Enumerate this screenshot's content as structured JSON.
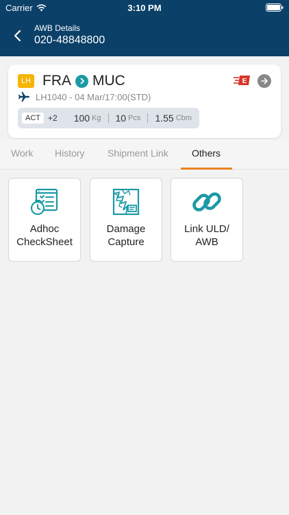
{
  "status_bar": {
    "carrier": "Carrier",
    "time": "3:10 PM"
  },
  "header": {
    "subtitle": "AWB Details",
    "title": "020-48848800"
  },
  "card": {
    "airline_badge": "LH",
    "origin": "FRA",
    "destination": "MUC",
    "flight": "LH1040 - 04 Mar/17:00(STD)",
    "act_label": "ACT",
    "act_extra": "+2",
    "weight": "100",
    "weight_unit": "Kg",
    "pieces": "10",
    "pieces_unit": "Pcs",
    "volume": "1.55",
    "volume_unit": "Cbm",
    "e_badge": "E"
  },
  "tabs": [
    {
      "label": "Work"
    },
    {
      "label": "History"
    },
    {
      "label": "Shipment Link"
    },
    {
      "label": "Others"
    }
  ],
  "active_tab": "Others",
  "tiles": [
    {
      "label": "Adhoc\nCheckSheet",
      "icon": "checksheet-icon"
    },
    {
      "label": "Damage\nCapture",
      "icon": "damage-capture-icon"
    },
    {
      "label": "Link ULD/\nAWB",
      "icon": "link-icon"
    }
  ],
  "colors": {
    "header_bg": "#0b4068",
    "teal": "#1a9aa5",
    "tab_accent": "#e8821e",
    "badge_yellow": "#f5b400",
    "e_red": "#d9342b"
  }
}
